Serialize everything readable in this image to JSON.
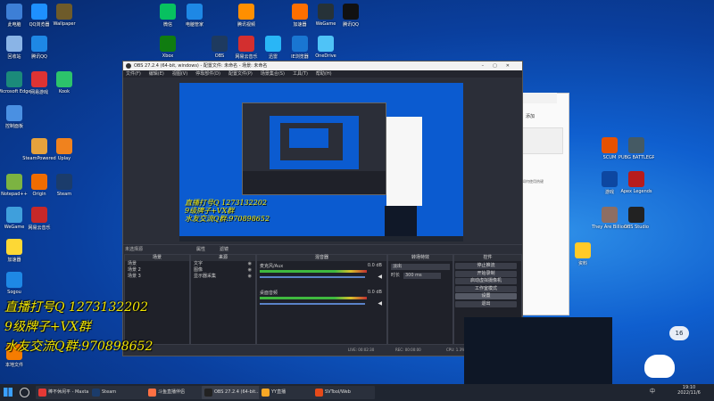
{
  "desktop": {
    "left_icons": [
      {
        "label": "此电脑",
        "color": "#3d7fd6"
      },
      {
        "label": "QQ浏览器",
        "color": "#1e90ff"
      },
      {
        "label": "Wallpaper",
        "color": "#6e5b2a"
      },
      {
        "label": "回收站",
        "color": "#8ab4e6"
      },
      {
        "label": "腾讯QQ",
        "color": "#1e88e5"
      },
      {
        "label": "Microsoft Edge",
        "color": "#1b8a7a"
      },
      {
        "label": "网易游戏",
        "color": "#d33"
      },
      {
        "label": "Kook",
        "color": "#2cc36b"
      },
      {
        "label": "控制面板",
        "color": "#4a90e2"
      },
      {
        "label": "SteamPowered",
        "color": "#e6a23c"
      },
      {
        "label": "Uplay",
        "color": "#f0821e"
      },
      {
        "label": "Notepad++",
        "color": "#7cb342"
      },
      {
        "label": "Origin",
        "color": "#ef6c00"
      },
      {
        "label": "Steam",
        "color": "#1b3c6b"
      },
      {
        "label": "WeGame",
        "color": "#3f9fdc"
      },
      {
        "label": "网易云音乐",
        "color": "#c62828"
      },
      {
        "label": "加速器",
        "color": "#fdd835"
      },
      {
        "label": "Sogou",
        "color": "#1e88e5"
      },
      {
        "label": "本地文件",
        "color": "#f57c00"
      }
    ],
    "top_icons": [
      {
        "label": "微信",
        "color": "#07c160"
      },
      {
        "label": "电脑管家",
        "color": "#1e88e5"
      },
      {
        "label": "腾讯视频",
        "color": "#ff8f00"
      },
      {
        "label": "加速器",
        "color": "#ff6f00"
      },
      {
        "label": "WeGame",
        "color": "#263238"
      },
      {
        "label": "腾讯QQ",
        "color": "#111"
      },
      {
        "label": "Xbox",
        "color": "#107c10"
      },
      {
        "label": "OBS",
        "color": "#1e3a5f"
      },
      {
        "label": "网易云音乐",
        "color": "#d32f2f"
      },
      {
        "label": "迅雷",
        "color": "#29b6f6"
      },
      {
        "label": "IE浏览器",
        "color": "#1976d2"
      },
      {
        "label": "OneDrive",
        "color": "#4fc3f7"
      }
    ],
    "right_icons": [
      {
        "label": "SCUM",
        "color": "#e65100"
      },
      {
        "label": "PUBG BATTLEGR...",
        "color": "#455a64"
      },
      {
        "label": "游戏",
        "color": "#0d47a1"
      },
      {
        "label": "Apex Legends",
        "color": "#b71c1c"
      },
      {
        "label": "They Are Billions",
        "color": "#8d6e63"
      },
      {
        "label": "OBS Studio",
        "color": "#222"
      },
      {
        "label": "资料",
        "color": "#ffca28"
      }
    ]
  },
  "obs": {
    "title": "OBS 27.2.4 (64-bit, windows) - 配置文件: 未命名 - 场景: 未命名",
    "menu": [
      "文件(F)",
      "编辑(E)",
      "视图(V)",
      "停靠部件(D)",
      "配置文件(P)",
      "场景集合(S)",
      "工具(T)",
      "帮助(H)"
    ],
    "no_source": "未选择源",
    "properties_button": "属性",
    "filters_button": "滤镜",
    "scenes_header": "场景",
    "scenes": [
      "场景",
      "场景 2",
      "场景 3"
    ],
    "sources_header": "来源",
    "sources": [
      "文字",
      "图像",
      "显示器采集"
    ],
    "mixer_header": "混音器",
    "mixer": [
      {
        "name": "麦克风/Aux",
        "db": "0.0 dB"
      },
      {
        "name": "桌面音频",
        "db": "0.0 dB"
      }
    ],
    "transitions_header": "转场特效",
    "transition_type": "淡出",
    "duration_label": "时长",
    "duration": "300 ms",
    "controls_header": "控件",
    "controls": [
      "停止推流",
      "开始录制",
      "启动虚拟摄像机",
      "工作室模式",
      "设置",
      "退出"
    ],
    "status": {
      "live": "LIVE: 00:02:30",
      "rec": "REC: 00:00:00",
      "cpu": "CPU: 1.3%, 30.00 fps"
    }
  },
  "overlay": {
    "line1": "直播打号Q 1273132202",
    "line2": "9级牌子+VX群",
    "line3": "水友交流Q群:970898652"
  },
  "side_window": {
    "title": "添加",
    "item1": "Tips",
    "item2": "如何使用热键"
  },
  "taskbar": {
    "items": [
      {
        "label": "棒不休闲平 - Maxta",
        "color": "#e53935"
      },
      {
        "label": "Steam",
        "color": "#1b3c6b"
      },
      {
        "label": "斗鱼直播伴侣",
        "color": "#ff7043"
      },
      {
        "label": "OBS 27.2.4 (64-bit...",
        "color": "#222"
      },
      {
        "label": "YY直播",
        "color": "#f9a825"
      },
      {
        "label": "SVTool/Web",
        "color": "#e64a19"
      }
    ],
    "time": "19:10",
    "date": "2022/11/6",
    "lang": "中",
    "weather_badge": "16"
  }
}
